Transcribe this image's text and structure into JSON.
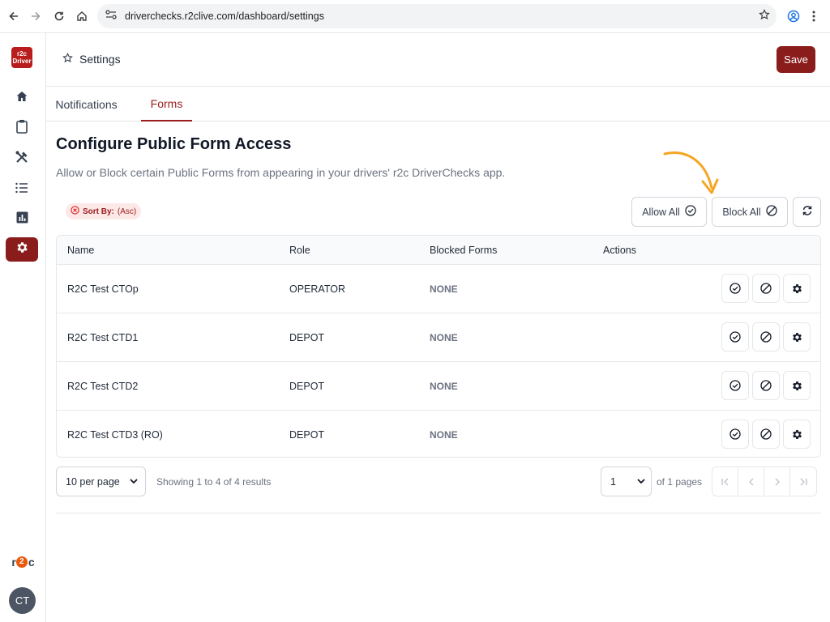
{
  "browser": {
    "url": "driverchecks.r2clive.com/dashboard/settings"
  },
  "sidebar": {
    "logo_text_top": "r2c",
    "logo_text_bottom": "Driver",
    "items": [
      {
        "name": "home"
      },
      {
        "name": "clipboard"
      },
      {
        "name": "tools"
      },
      {
        "name": "list"
      },
      {
        "name": "chart"
      },
      {
        "name": "settings",
        "active": true
      }
    ],
    "brand_logo": {
      "left": "r",
      "mid": "2",
      "right": "c"
    },
    "avatar_initials": "CT"
  },
  "header": {
    "title": "Settings",
    "save_label": "Save"
  },
  "tabs": [
    {
      "label": "Notifications",
      "active": false
    },
    {
      "label": "Forms",
      "active": true
    }
  ],
  "content": {
    "heading": "Configure Public Form Access",
    "subheading": "Allow or Block certain Public Forms from appearing in your drivers' r2c DriverChecks app.",
    "sort_chip": {
      "label": "Sort By:",
      "value": "(Asc)"
    },
    "allow_all_label": "Allow All",
    "block_all_label": "Block All"
  },
  "table": {
    "columns": [
      "Name",
      "Role",
      "Blocked Forms",
      "Actions"
    ],
    "rows": [
      {
        "name": "R2C Test CTOp",
        "role": "OPERATOR",
        "blocked": "NONE"
      },
      {
        "name": "R2C Test CTD1",
        "role": "DEPOT",
        "blocked": "NONE"
      },
      {
        "name": "R2C Test CTD2",
        "role": "DEPOT",
        "blocked": "NONE"
      },
      {
        "name": "R2C Test CTD3 (RO)",
        "role": "DEPOT",
        "blocked": "NONE"
      }
    ]
  },
  "pagination": {
    "per_page": "10 per page",
    "showing": "Showing 1 to 4 of 4 results",
    "current_page": "1",
    "of_pages": "of 1 pages"
  },
  "colors": {
    "accent": "#8b1c1c",
    "annotation_arrow": "#f5a623"
  }
}
